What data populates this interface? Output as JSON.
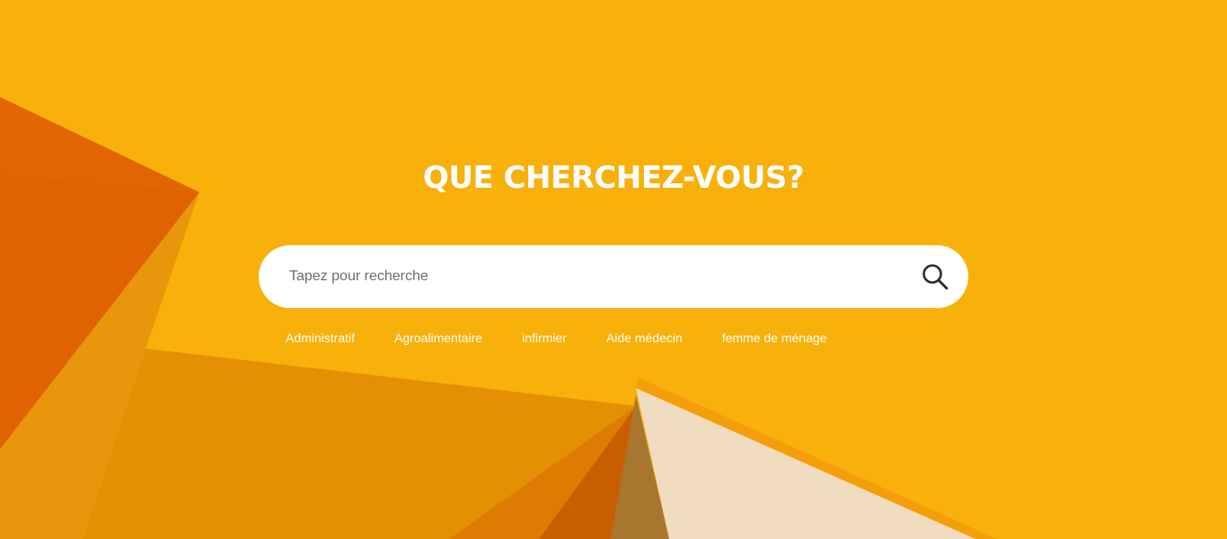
{
  "hero": {
    "title": "QUE CHERCHEZ-VOUS?"
  },
  "search": {
    "placeholder": "Tapez pour recherche",
    "value": "",
    "icon": "search-icon"
  },
  "suggestions": [
    {
      "label": "Administratif"
    },
    {
      "label": "Agroalimentaire"
    },
    {
      "label": "infirmier"
    },
    {
      "label": "Aide médecin"
    },
    {
      "label": "femme de ménage"
    }
  ],
  "colors": {
    "background": "#F8B00A",
    "title": "#FFFFFF",
    "search_box": "#FFFFFF",
    "accent_dark_orange": "#E26503",
    "accent_mid_orange": "#E39002",
    "accent_cream": "#F0DCBE"
  }
}
